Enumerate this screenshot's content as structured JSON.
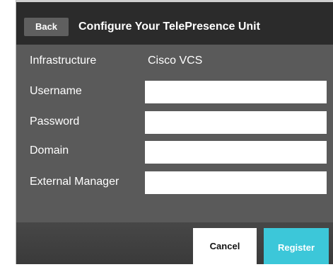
{
  "header": {
    "back_label": "Back",
    "title": "Configure Your TelePresence Unit"
  },
  "form": {
    "infrastructure": {
      "label": "Infrastructure",
      "value": "Cisco VCS"
    },
    "username": {
      "label": "Username",
      "value": ""
    },
    "password": {
      "label": "Password",
      "value": ""
    },
    "domain": {
      "label": "Domain",
      "value": ""
    },
    "external_manager": {
      "label": "External Manager",
      "value": ""
    }
  },
  "footer": {
    "cancel_label": "Cancel",
    "register_label": "Register"
  },
  "colors": {
    "header_bg": "#2b2b2b",
    "body_bg": "#5a5a5a",
    "accent": "#3cc7d9"
  }
}
